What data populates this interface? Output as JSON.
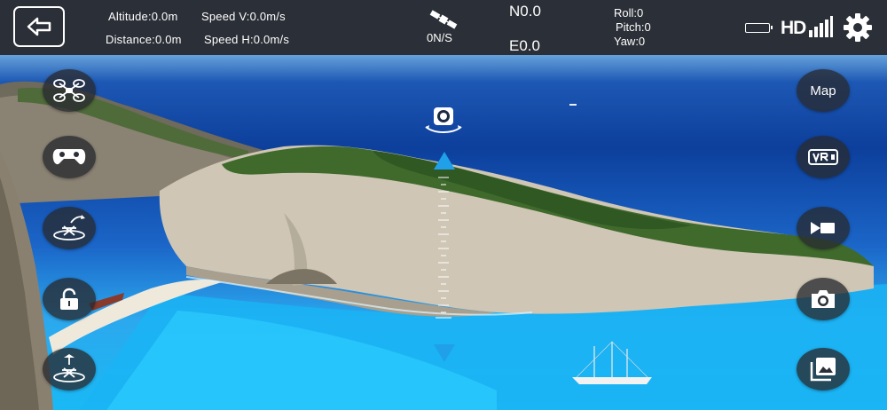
{
  "telemetry": {
    "altitude": "Altitude:0.0m",
    "speed_v": "Speed V:0.0m/s",
    "distance": "Distance:0.0m",
    "speed_h": "Speed H:0.0m/s"
  },
  "gps": {
    "satellite_value": "0N/S",
    "north": "N0.0",
    "east": "E0.0"
  },
  "attitude": {
    "roll": "Roll:0",
    "pitch": "Pitch:0",
    "yaw": "Yaw:0"
  },
  "status": {
    "hd_label": "HD",
    "battery_icon": "battery-icon",
    "signal_icon": "signal-bars-icon",
    "settings_icon": "gear-icon"
  },
  "left_controls": [
    "drone-icon",
    "gamepad-icon",
    "takeoff-icon",
    "lock-icon",
    "landing-icon"
  ],
  "right_controls": {
    "map_label": "Map",
    "icons": [
      "vr-icon",
      "video-record-icon",
      "camera-icon",
      "gallery-icon"
    ]
  },
  "colors": {
    "topbar_bg": "#2b2f37",
    "button_bg": "rgba(40,42,48,0.78)",
    "hud_arrow": "#1fa0e8"
  }
}
